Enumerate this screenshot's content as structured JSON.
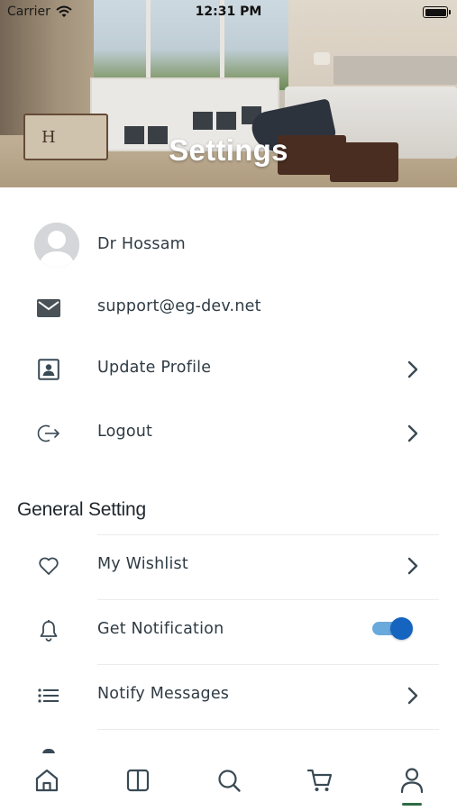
{
  "status_bar": {
    "carrier": "Carrier",
    "time": "12:31 PM"
  },
  "header": {
    "title": "Settings"
  },
  "account": {
    "user_name": "Dr Hossam",
    "email": "support@eg-dev.net",
    "items": [
      {
        "label": "Update Profile",
        "icon": "profile-card-icon"
      },
      {
        "label": "Logout",
        "icon": "logout-icon"
      }
    ]
  },
  "general_setting": {
    "title": "General Setting",
    "items": [
      {
        "label": "My Wishlist",
        "icon": "heart-icon"
      },
      {
        "label": "Get Notification",
        "icon": "bell-icon",
        "toggle_on": true
      },
      {
        "label": "Notify Messages",
        "icon": "list-icon"
      }
    ]
  },
  "tab_bar": {
    "tabs": [
      {
        "icon": "home-icon"
      },
      {
        "icon": "categories-icon"
      },
      {
        "icon": "search-icon"
      },
      {
        "icon": "cart-icon"
      },
      {
        "icon": "user-icon",
        "active": true
      }
    ]
  },
  "colors": {
    "icon": "#3a4a54",
    "text": "#2f3b44",
    "toggle_knob": "#1565c0",
    "toggle_track": "#6aa9dc",
    "active_tab_indicator": "#2e6b45"
  }
}
